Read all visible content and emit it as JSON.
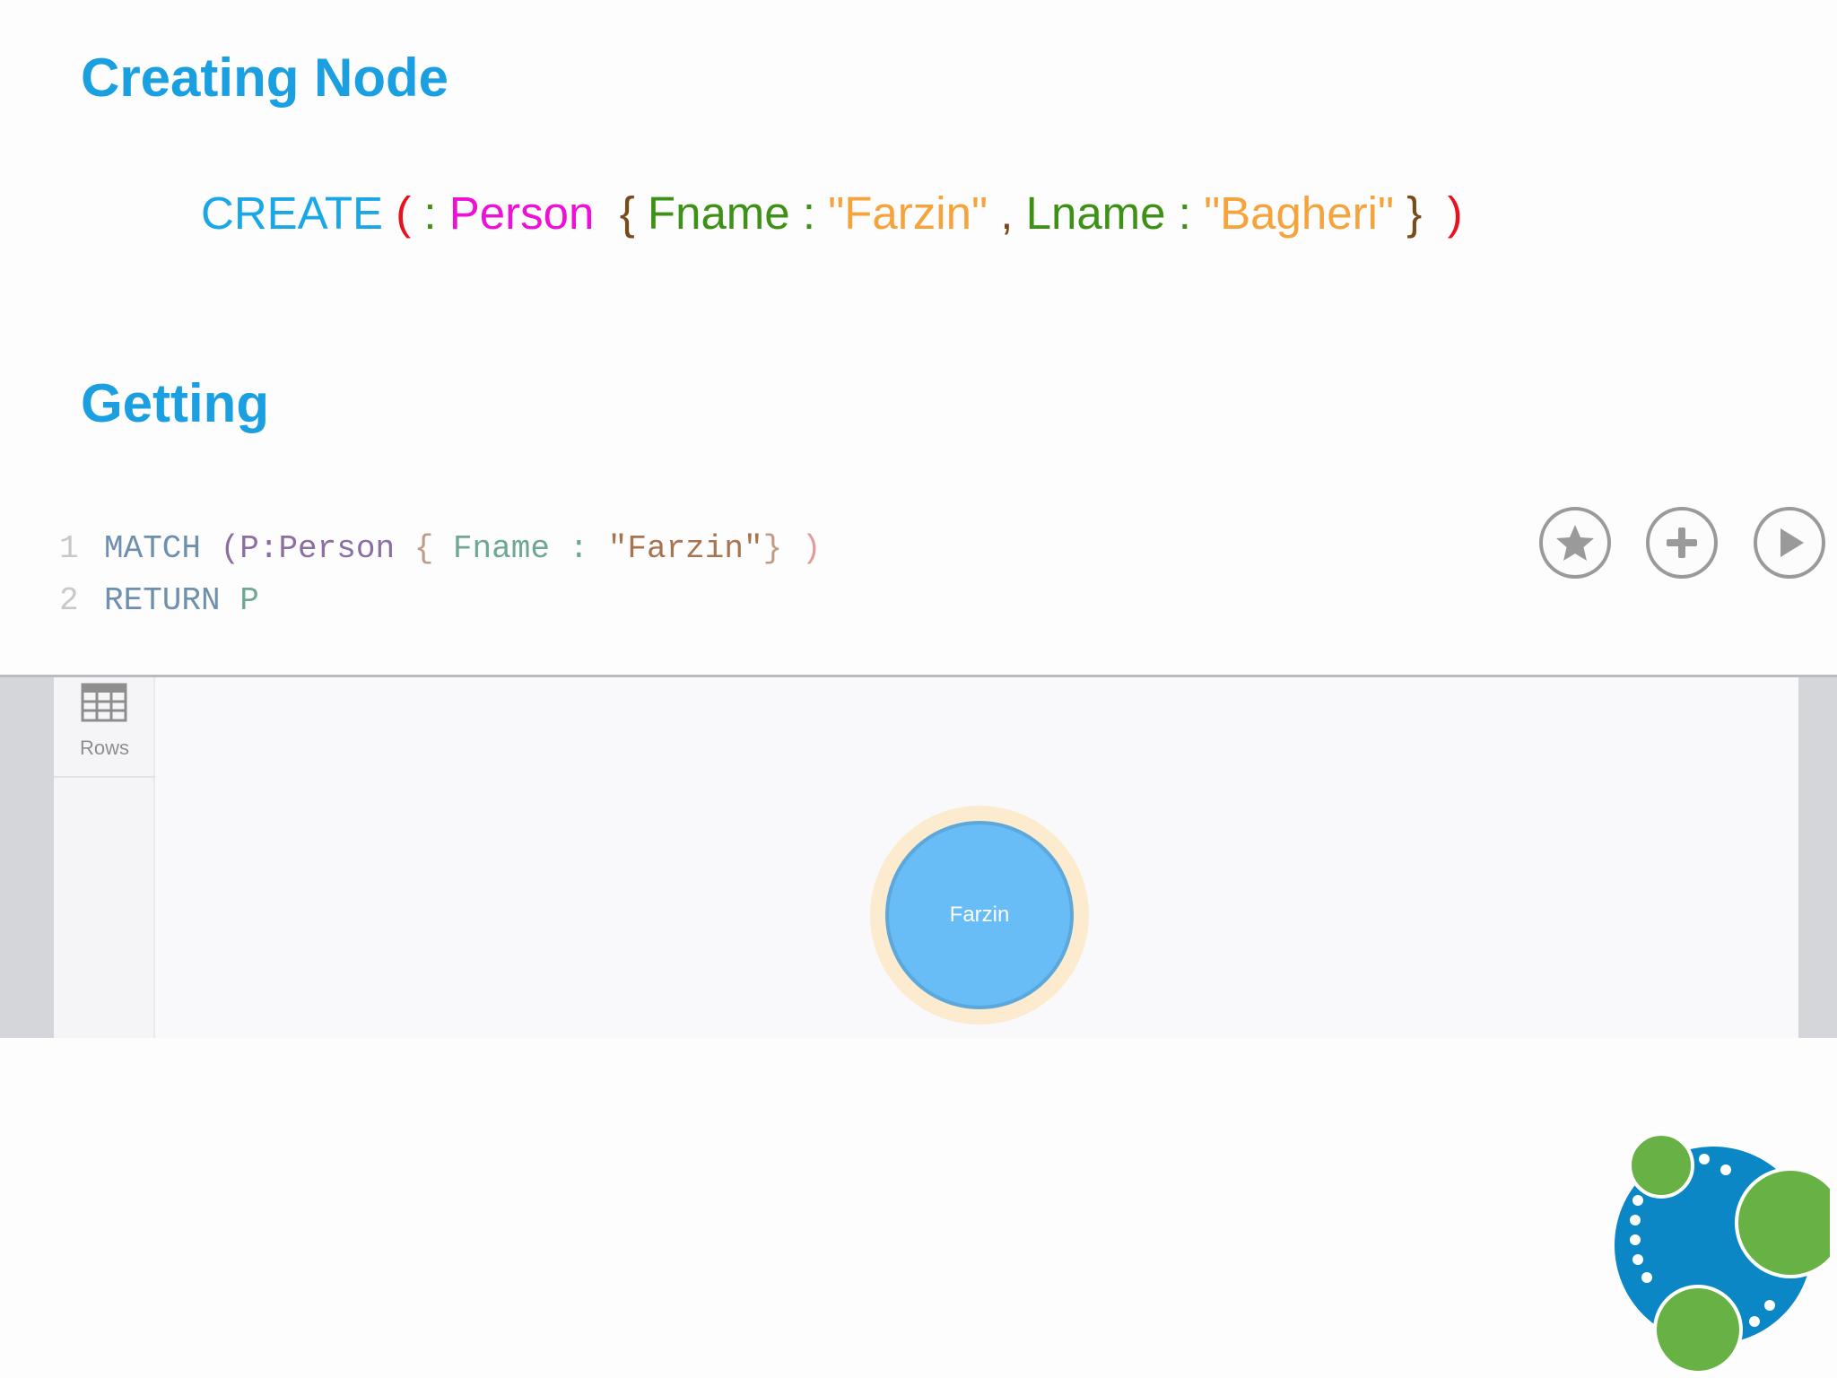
{
  "headings": {
    "creating": "Creating Node",
    "getting": "Getting"
  },
  "create_statement": {
    "keyword": "CREATE",
    "open_paren": "(",
    "colon": ":",
    "label": "Person",
    "open_brace": "{",
    "key1": "Fname",
    "sep1": ":",
    "val1": "\"Farzin\"",
    "comma": ",",
    "key2": "Lname",
    "sep2": ":",
    "val2": "\"Bagheri\"",
    "close_brace": "}",
    "close_paren": ")"
  },
  "editor": {
    "line1": {
      "number": "1",
      "keyword": "MATCH",
      "open_paren": "(P:",
      "label": "Person",
      "open_brace": "{",
      "key": "Fname",
      "colon": ":",
      "value": "\"Farzin\"",
      "close_brace": "}",
      "close_paren": ")"
    },
    "line2": {
      "number": "2",
      "keyword": "RETURN",
      "variable": "P"
    },
    "buttons": {
      "favorite_icon": "star-icon",
      "add_icon": "plus-icon",
      "run_icon": "play-icon"
    }
  },
  "result": {
    "rows_tab_label": "Rows",
    "rows_icon": "table-icon",
    "node_label": "Farzin"
  },
  "colors": {
    "heading": "#1a9fe0",
    "keyword_blue": "#1aa7e8",
    "paren_red": "#e8121e",
    "label_magenta": "#ee10d6",
    "brace_brown": "#7a4b1a",
    "key_green": "#3d9216",
    "string_orange": "#f5a43c",
    "node_fill": "#68bdf6",
    "node_halo": "#fcebcf"
  }
}
